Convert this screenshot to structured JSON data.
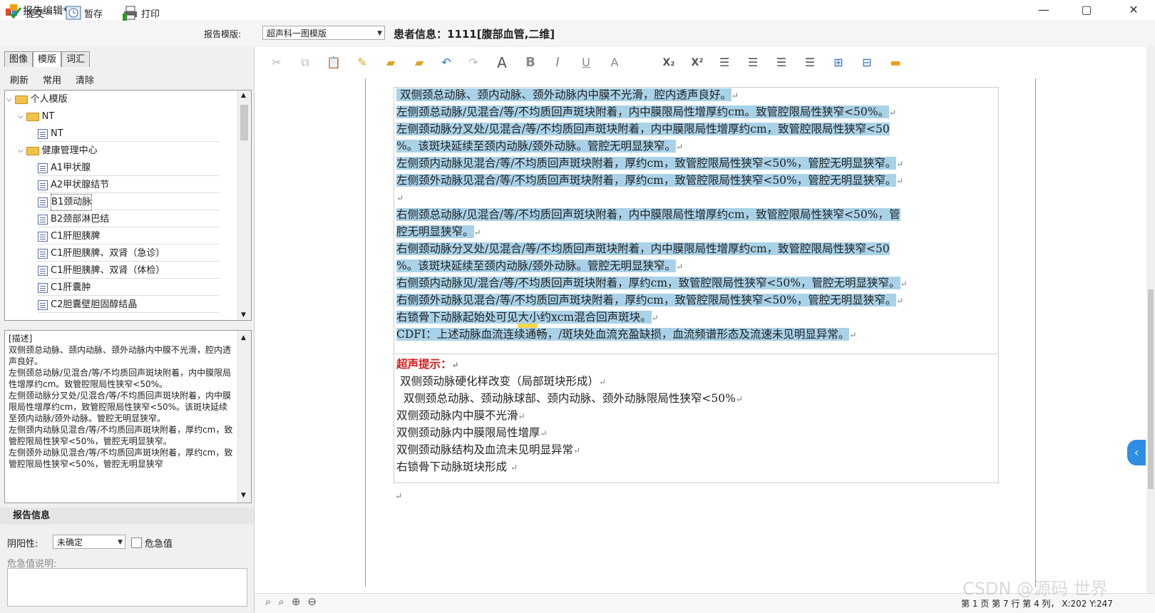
{
  "window": {
    "title": "报告编辑*",
    "controls": [
      "—",
      "▢",
      "✕"
    ]
  },
  "toolbar": {
    "submit": "提交",
    "save_temp": "暂存",
    "print": "打印",
    "template_label": "报告模版:",
    "template_value": "超声科一图模版",
    "patient_info": "患者信息：1111[腹部血管,二维]"
  },
  "left": {
    "tabs": [
      "图像",
      "模版",
      "词汇"
    ],
    "active_tab": "模版",
    "actions": [
      "刷新",
      "常用",
      "清除"
    ],
    "tree": [
      {
        "label": "个人模版",
        "type": "folder",
        "level": 0
      },
      {
        "label": "NT",
        "type": "folder",
        "level": 1
      },
      {
        "label": "NT",
        "type": "doc",
        "level": 2
      },
      {
        "label": "健康管理中心",
        "type": "folder",
        "level": 1
      },
      {
        "label": "A1甲状腺",
        "type": "doc",
        "level": 2
      },
      {
        "label": "A2甲状腺结节",
        "type": "doc",
        "level": 2
      },
      {
        "label": "B1颈动脉",
        "type": "doc",
        "level": 2,
        "selected": true
      },
      {
        "label": "B2颈部淋巴结",
        "type": "doc",
        "level": 2
      },
      {
        "label": "C1肝胆胰脾",
        "type": "doc",
        "level": 2
      },
      {
        "label": "C1肝胆胰脾、双肾（急诊）",
        "type": "doc",
        "level": 2
      },
      {
        "label": "C1肝胆胰脾、双肾（体检）",
        "type": "doc",
        "level": 2
      },
      {
        "label": "C1肝囊肿",
        "type": "doc",
        "level": 2
      },
      {
        "label": "C2胆囊壁胆固醇结晶",
        "type": "doc",
        "level": 2
      }
    ],
    "description": "[描述]\n双侧颈总动脉、颈内动脉、颈外动脉内中膜不光滑，腔内透声良好。\n左侧颈总动脉/见混合/等/不均质回声斑块附着，内中膜限局性增厚约cm。致管腔限局性狭窄<50%。\n左侧颈动脉分叉处/见混合/等/不均质回声斑块附着，内中膜限局性增厚约cm，致管腔限局性狭窄<50%。该斑块延续至颈内动脉/颈外动脉。管腔无明显狭窄。\n左侧颈内动脉见混合/等/不均质回声斑块附着，厚约cm，致管腔限局性狭窄<50%，管腔无明显狭窄。\n左侧颈外动脉见混合/等/不均质回声斑块附着，厚约cm，致管腔限局性狭窄<50%，管腔无明显狭窄",
    "info_header": "报告信息",
    "yinyang_label": "阴阳性:",
    "yinyang_value": "未确定",
    "critical_label": "危急值",
    "critical_desc_label": "危急值说明:"
  },
  "editor": {
    "lines": [
      "双侧颈总动脉、颈内动脉、颈外动脉内中膜不光滑，腔内透声良好。",
      "左侧颈总动脉/见混合/等/不均质回声斑块附着，内中膜限局性增厚约cm。致管腔限局性狭窄<50%。",
      "左侧颈动脉分叉处/见混合/等/不均质回声斑块附着，内中膜限局性增厚约cm，致管腔限局性狭窄<50",
      "%。该斑块延续至颈内动脉/颈外动脉。管腔无明显狭窄。",
      "左侧颈内动脉见混合/等/不均质回声斑块附着，厚约cm，致管腔限局性狭窄<50%，管腔无明显狭窄。",
      "左侧颈外动脉见混合/等/不均质回声斑块附着，厚约cm，致管腔限局性狭窄<50%，管腔无明显狭窄。",
      "",
      "右侧颈总动脉/见混合/等/不均质回声斑块附着，内中膜限局性增厚约cm，致管腔限局性狭窄<50%，管",
      "腔无明显狭窄。",
      "右侧颈动脉分叉处/见混合/等/不均质回声斑块附着，内中膜限局性增厚约cm，致管腔限局性狭窄<50",
      "%。该斑块延续至颈内动脉/颈外动脉。管腔无明显狭窄。",
      "右侧颈内动脉见/混合/等/不均质回声斑块附着，厚约cm，致管腔限局性狭窄<50%，管腔无明显狭窄。",
      "右侧颈外动脉见混合/等/不均质回声斑块附着，厚约cm，致管腔限局性狭窄<50%，管腔无明显狭窄。",
      "右锁骨下动脉起始处可见大小约xcm混合回声斑块。",
      "CDFI：上述动脉血流连续通畅，/斑块处血流充盈缺损，血流频谱形态及流速未见明显异常。"
    ],
    "hint_title": "超声提示：",
    "hint_lines": [
      "双侧颈动脉硬化样改变（局部斑块形成）",
      "双侧颈总动脉、颈动脉球部、颈内动脉、颈外动脉限局性狭窄<50%",
      "双侧颈动脉内中膜不光滑",
      "双侧颈动脉内中膜限局性增厚",
      "双侧颈动脉结构及血流未见明显异常",
      "右锁骨下动脉斑块形成"
    ],
    "format_buttons": [
      "cut",
      "copy",
      "paste",
      "format-painter",
      "open",
      "new-folder",
      "undo",
      "redo",
      "A",
      "B",
      "I",
      "U",
      "A-color",
      "X₂",
      "X²",
      "align-left",
      "align-right",
      "align-center",
      "justify",
      "table",
      "hierarchy",
      "comment"
    ]
  },
  "status": {
    "text": "第 1 页 第 7 行 第 4 列，  X:202 Y:247",
    "watermark": "CSDN @源码 世界"
  },
  "colors": {
    "highlight": "#a9d2e8",
    "hint_red": "#d61b1b",
    "accent_blue": "#2f8de4"
  }
}
